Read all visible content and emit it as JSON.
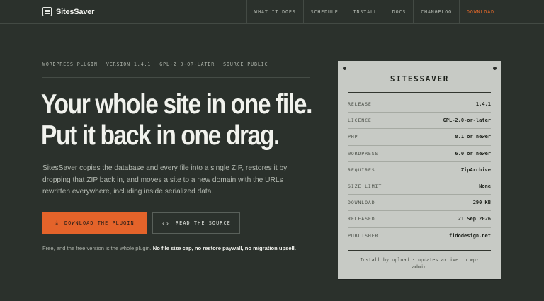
{
  "brand": {
    "name": "SitesSaver",
    "icon": "menu-icon"
  },
  "nav": [
    {
      "id": "what",
      "label": "WHAT IT DOES"
    },
    {
      "id": "schedule",
      "label": "SCHEDULE"
    },
    {
      "id": "install",
      "label": "INSTALL"
    },
    {
      "id": "docs",
      "label": "DOCS"
    },
    {
      "id": "changelog",
      "label": "CHANGELOG"
    },
    {
      "id": "download",
      "label": "DOWNLOAD",
      "accent": true
    }
  ],
  "hero": {
    "meta": [
      "WORDPRESS PLUGIN",
      "VERSION 1.4.1",
      "GPL-2.0-OR-LATER",
      "SOURCE PUBLIC"
    ],
    "headline_line1": "Your whole site in one file.",
    "headline_line2": "Put it back in one drag.",
    "description": "SitesSaver copies the database and every file into a single ZIP, restores it by dropping that ZIP back in, and moves a site to a new domain with the URLs rewritten everywhere, including inside serialized data.",
    "primary_button": {
      "label": "DOWNLOAD THE PLUGIN",
      "icon": "download-icon"
    },
    "secondary_button": {
      "label": "READ THE SOURCE",
      "icon": "code-icon"
    },
    "note_plain": "Free, and the free version is the whole plugin. ",
    "note_bold": "No file size cap, no restore paywall, no migration upsell."
  },
  "card": {
    "title": "SITESSAVER",
    "rows": [
      {
        "label": "RELEASE",
        "value": "1.4.1"
      },
      {
        "label": "LICENCE",
        "value": "GPL-2.0-or-later"
      },
      {
        "label": "PHP",
        "value": "8.1 or newer"
      },
      {
        "label": "WORDPRESS",
        "value": "6.0 or newer"
      },
      {
        "label": "REQUIRES",
        "value": "ZipArchive"
      },
      {
        "label": "SIZE LIMIT",
        "value": "None"
      },
      {
        "label": "DOWNLOAD",
        "value": "290 KB"
      },
      {
        "label": "RELEASED",
        "value": "21 Sep 2026"
      },
      {
        "label": "PUBLISHER",
        "value": "fidodesign.net"
      }
    ],
    "footer": "Install by upload · updates arrive in wp-admin"
  },
  "colors": {
    "background": "#2b312c",
    "accent": "#e4632a",
    "card": "#c7cac5",
    "text": "#e6e8e3"
  }
}
